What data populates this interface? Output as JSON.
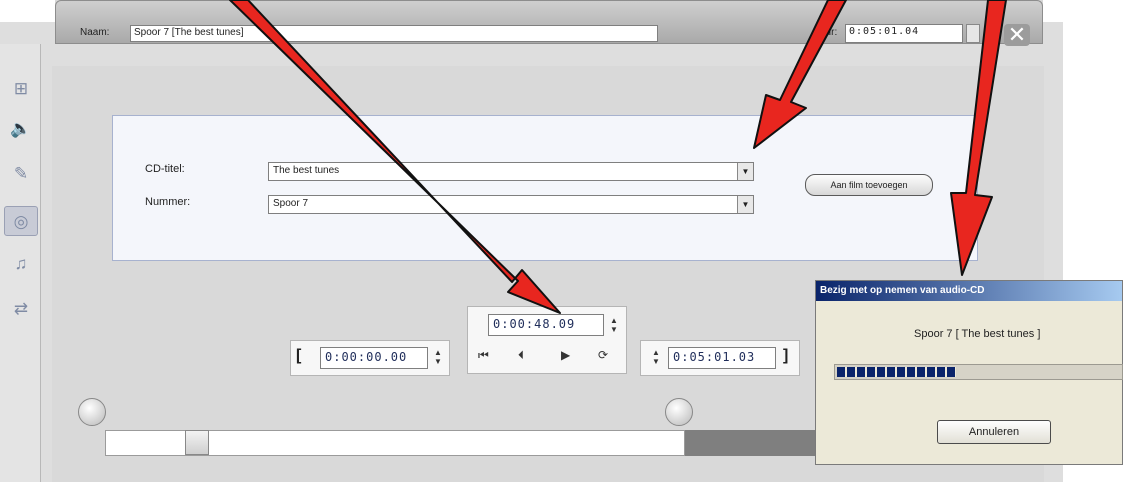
{
  "titlebar": {
    "name_label": "Naam:",
    "name_value": "Spoor 7 [The best tunes]",
    "duration_label": "uur:",
    "duration_value": "0:05:01.04",
    "close_glyph": "✕"
  },
  "sidebar": {
    "items": [
      {
        "icon": "video-tools-icon",
        "glyph": "⊞"
      },
      {
        "icon": "audio-volume-icon",
        "glyph": "🔈"
      },
      {
        "icon": "voiceover-icon",
        "glyph": "✎"
      },
      {
        "icon": "cd-audio-icon",
        "glyph": "◎"
      },
      {
        "icon": "music-icon",
        "glyph": "♫"
      },
      {
        "icon": "effects-icon",
        "glyph": "⇄"
      }
    ]
  },
  "cd_panel": {
    "cd_title_label": "CD-titel:",
    "cd_title_value": "The best tunes",
    "track_label": "Nummer:",
    "track_value": "Spoor 7",
    "add_button": "Aan film toevoegen"
  },
  "transport": {
    "current_time": "0:00:48.09",
    "start_time": "0:00:00.00",
    "end_time": "0:05:01.03",
    "bracket_open": "[",
    "bracket_close": "]",
    "buttons": [
      "⏮",
      "⏴",
      "▶",
      "⟳"
    ]
  },
  "dialog": {
    "title": "Bezig met op nemen van audio-CD",
    "track_text": "Spoor 7 [ The best tunes ]",
    "progress_fraction": 0.42,
    "cancel_button": "Annuleren"
  },
  "colors": {
    "arrow": "#e8261f",
    "dialog_title_start": "#0a246a",
    "dialog_title_end": "#a6caf0"
  }
}
